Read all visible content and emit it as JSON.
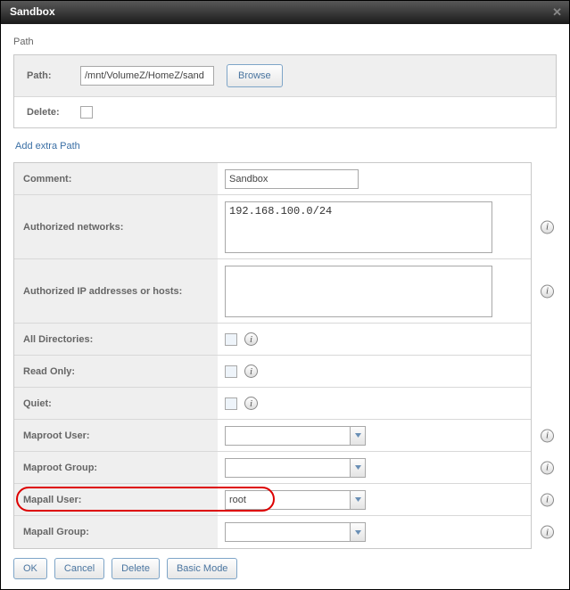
{
  "window": {
    "title": "Sandbox"
  },
  "path_section": {
    "heading": "Path",
    "path_label": "Path:",
    "path_value": "/mnt/VolumeZ/HomeZ/sand",
    "browse": "Browse",
    "delete_label": "Delete:",
    "add_extra": "Add extra Path"
  },
  "form": {
    "comment": {
      "label": "Comment:",
      "value": "Sandbox"
    },
    "auth_networks": {
      "label": "Authorized networks:",
      "value": "192.168.100.0/24"
    },
    "auth_hosts": {
      "label": "Authorized IP addresses or hosts:",
      "value": ""
    },
    "all_dirs": {
      "label": "All Directories:"
    },
    "read_only": {
      "label": "Read Only:"
    },
    "quiet": {
      "label": "Quiet:"
    },
    "maproot_user": {
      "label": "Maproot User:",
      "value": ""
    },
    "maproot_group": {
      "label": "Maproot Group:",
      "value": ""
    },
    "mapall_user": {
      "label": "Mapall User:",
      "value": "root"
    },
    "mapall_group": {
      "label": "Mapall Group:",
      "value": ""
    }
  },
  "buttons": {
    "ok": "OK",
    "cancel": "Cancel",
    "delete": "Delete",
    "basic_mode": "Basic Mode"
  },
  "icons": {
    "info": "i"
  }
}
